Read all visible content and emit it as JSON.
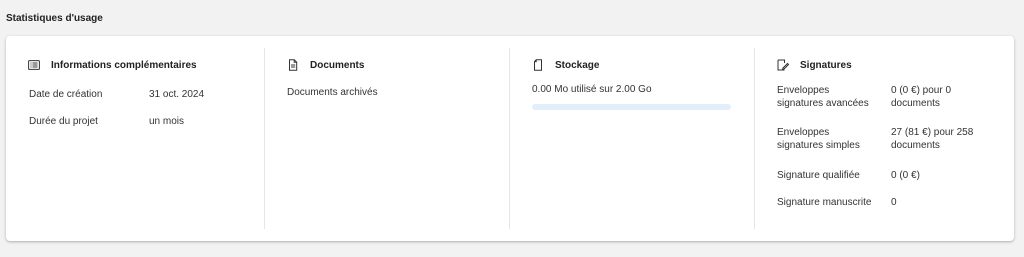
{
  "section_title": "Statistiques d'usage",
  "info": {
    "title": "Informations complémentaires",
    "icon": "list-icon",
    "rows": [
      {
        "label": "Date de création",
        "value": "31 oct. 2024"
      },
      {
        "label": "Durée du projet",
        "value": "un mois"
      }
    ]
  },
  "documents": {
    "title": "Documents",
    "icon": "document-icon",
    "archived_label": "Documents archivés"
  },
  "storage": {
    "title": "Stockage",
    "icon": "file-icon",
    "usage_text": "0.00 Mo utilisé sur 2.00 Go",
    "used_fraction": 0.0
  },
  "signatures": {
    "title": "Signatures",
    "icon": "signature-icon",
    "rows": [
      {
        "label_line1": "Enveloppes",
        "label_line2": "signatures avancées",
        "value_line1": "0 (0 €) pour 0",
        "value_line2": "documents"
      },
      {
        "label_line1": "Enveloppes",
        "label_line2": "signatures simples",
        "value_line1": "27 (81 €) pour 258",
        "value_line2": "documents"
      },
      {
        "label_line1": "Signature qualifiée",
        "label_line2": "",
        "value_line1": "0 (0 €)",
        "value_line2": ""
      },
      {
        "label_line1": "Signature manuscrite",
        "label_line2": "",
        "value_line1": "0",
        "value_line2": ""
      }
    ]
  },
  "colors": {
    "progress_track": "#e3eefb",
    "progress_fill": "#3b82f6",
    "card_bg": "#ffffff",
    "page_bg": "#f2f2f2"
  }
}
